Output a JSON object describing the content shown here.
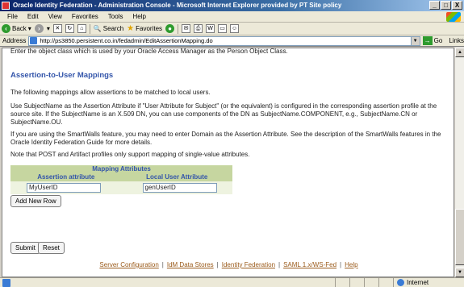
{
  "window": {
    "title": "Oracle Identity Federation - Administration Console - Microsoft Internet Explorer provided by PT Site policy",
    "controls": [
      "_",
      "□",
      "X"
    ]
  },
  "menu": [
    "File",
    "Edit",
    "View",
    "Favorites",
    "Tools",
    "Help"
  ],
  "toolbar": {
    "back_label": "Back",
    "search_label": "Search",
    "favorites_label": "Favorites"
  },
  "address": {
    "label": "Address",
    "url": "http://ps3850.persistent.co.in/fedadmin/EditAssertionMapping.do",
    "go_label": "Go",
    "links_label": "Links"
  },
  "page": {
    "intro": "Enter the object class which is used by your Oracle Access Manager as the Person Object Class.",
    "heading": "Assertion-to-User Mappings",
    "para1": "The following mappings allow assertions to be matched to local users.",
    "para2": "Use SubjectName as the Assertion Attribute if \"User Attribute for Subject\" (or the equivalent) is configured in the corresponding assertion profile at the source site. If the SubjectName is an X.509 DN, you can use components of the DN as SubjectName.COMPONENT, e.g., SubjectName.CN or SubjectName.OU.",
    "para3": "If you are using the SmartWalls feature, you may need to enter Domain as the Assertion Attribute. See the description of the SmartWalls features in the Oracle Identity Federation Guide for more details.",
    "para4": "Note that POST and Artifact profiles only support mapping of single-value attributes.",
    "mapping_table": {
      "title": "Mapping Attributes",
      "col_assertion": "Assertion attribute",
      "col_local": "Local User Attribute",
      "row": {
        "assertion_value": "MyUserID",
        "local_value": "genUserID"
      }
    },
    "add_row_label": "Add New Row",
    "submit_label": "Submit",
    "reset_label": "Reset",
    "footer_links": [
      "Server Configuration",
      "IdM Data Stores",
      "Identity Federation",
      "SAML 1.x/WS-Fed",
      "Help"
    ]
  },
  "status": {
    "zone": "Internet"
  }
}
